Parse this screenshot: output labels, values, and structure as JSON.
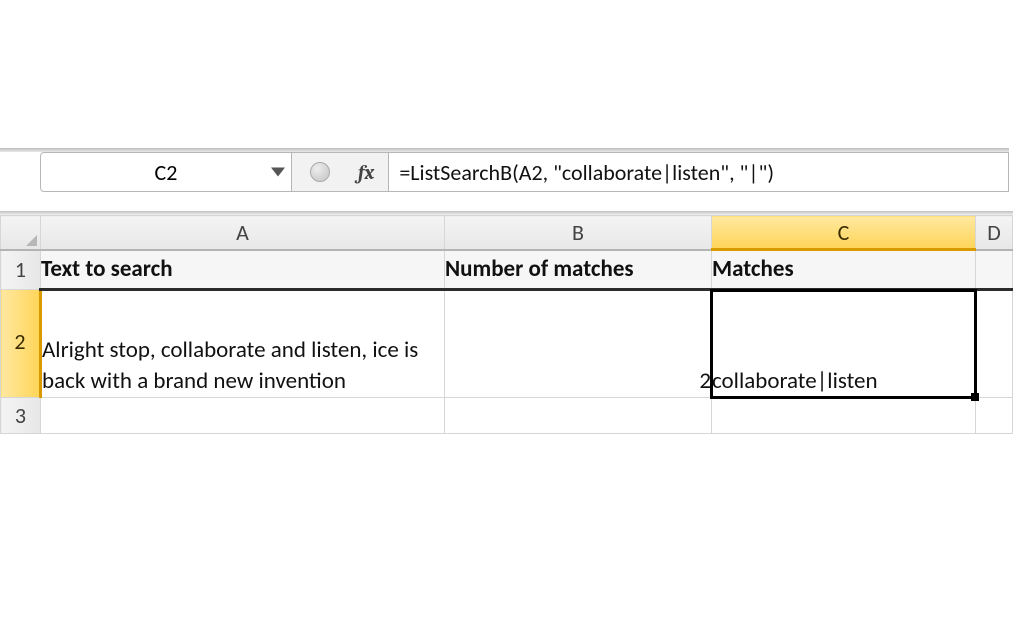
{
  "formula_bar": {
    "name_box": "C2",
    "fx_label": "fx",
    "formula": "=ListSearchB(A2, \"collaborate|listen\", \"|\")"
  },
  "columns": {
    "A": "A",
    "B": "B",
    "C": "C",
    "D": "D"
  },
  "row_numbers": {
    "r1": "1",
    "r2": "2",
    "r3": "3"
  },
  "headers": {
    "A": "Text to search",
    "B": "Number of matches",
    "C": "Matches"
  },
  "rows": [
    {
      "A": "Alright stop, collaborate and listen, ice is back with a brand new invention",
      "B": "2",
      "C": "collaborate|listen"
    }
  ],
  "active_cell": "C2"
}
